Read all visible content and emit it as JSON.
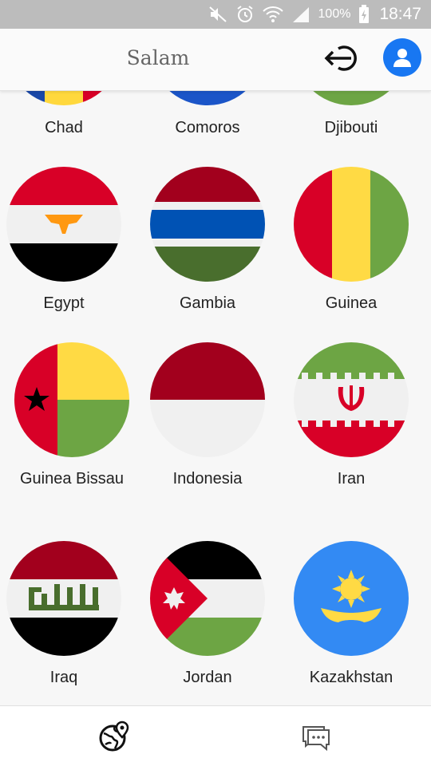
{
  "status_bar": {
    "battery": "100%",
    "time": "18:47",
    "icons": [
      "mute-icon",
      "alarm-icon",
      "wifi-icon",
      "signal-icon",
      "battery-charging-icon"
    ]
  },
  "app_bar": {
    "title": "Salam",
    "icons": [
      "logout-icon",
      "profile-icon"
    ],
    "accent_color": "#1877f2"
  },
  "countries": [
    {
      "name": "Chad"
    },
    {
      "name": "Comoros"
    },
    {
      "name": "Djibouti"
    },
    {
      "name": "Egypt"
    },
    {
      "name": "Gambia"
    },
    {
      "name": "Guinea"
    },
    {
      "name": "Guinea Bissau"
    },
    {
      "name": "Indonesia"
    },
    {
      "name": "Iran"
    },
    {
      "name": "Iraq"
    },
    {
      "name": "Jordan"
    },
    {
      "name": "Kazakhstan"
    }
  ],
  "bottom_nav": {
    "icons": [
      "globe-location-icon",
      "chat-icon"
    ]
  }
}
